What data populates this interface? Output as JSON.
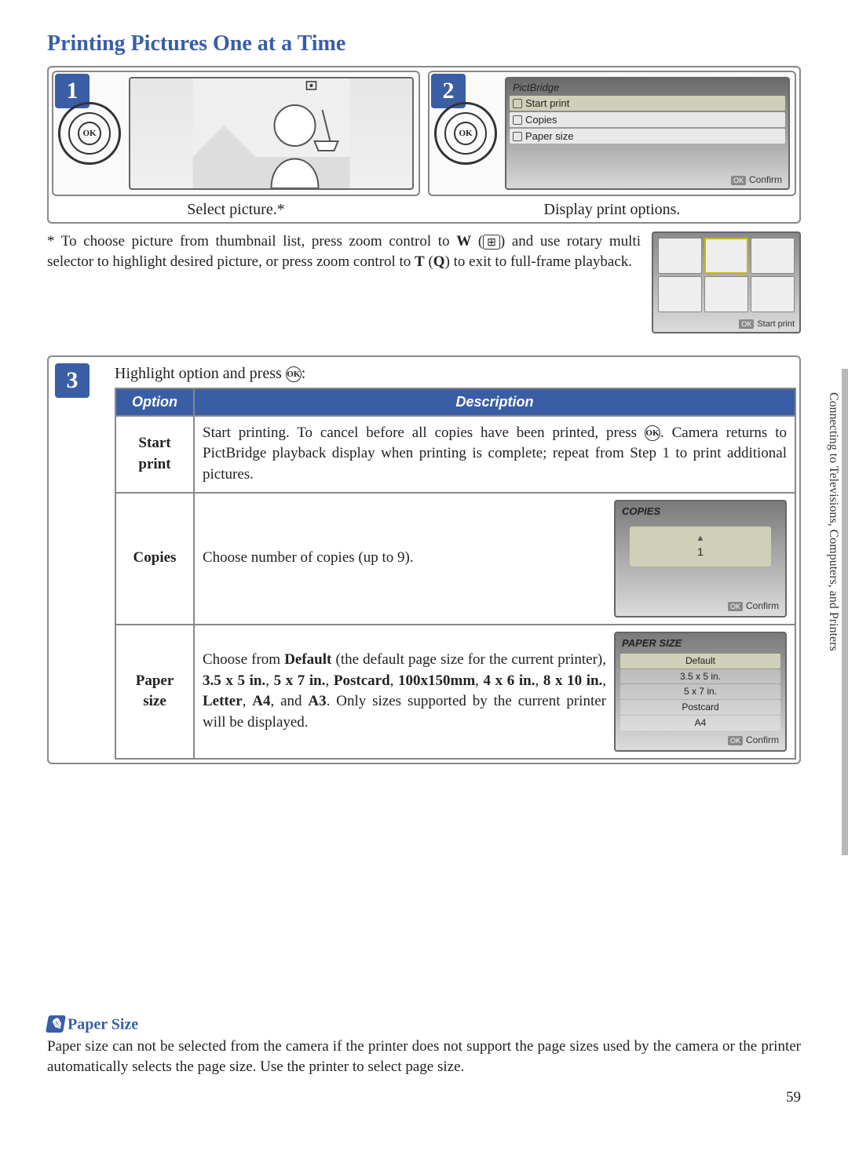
{
  "title": "Printing Pictures One at a Time",
  "sideTab": "Connecting to Televisions, Computers, and Printers",
  "pageNumber": "59",
  "steps": {
    "s1": {
      "num": "1",
      "caption": "Select picture.*"
    },
    "s2": {
      "num": "2",
      "caption": "Display print options.",
      "menuTitle": "PictBridge",
      "menu": {
        "startPrint": "Start print",
        "copies": "Copies",
        "paperSize": "Paper size",
        "confirm": "Confirm"
      }
    }
  },
  "footnote": {
    "line1a": "* To choose picture from thumbnail list, press zoom control to ",
    "w": "W",
    "line1b": " (",
    "thumbSym": "⊞",
    "line1c": ") and use rotary multi selector to highlight desired picture, or press zoom control to ",
    "t": "T",
    "q": "Q",
    "line1d": ") to exit to full-frame playback.",
    "thumbFooter": "Start print"
  },
  "step3": {
    "num": "3",
    "intro": "Highlight option and press ",
    "headers": {
      "option": "Option",
      "description": "Description"
    },
    "rows": {
      "startPrint": {
        "name": "Start print",
        "desc1": "Start printing.  To cancel before all copies have been printed, press ",
        "desc2": ". Camera returns to PictBridge playback display when printing is complete; repeat from Step 1 to print additional pictures."
      },
      "copies": {
        "name": "Copies",
        "desc": "Choose number of copies (up to 9).",
        "screenTitle": "COPIES",
        "value": "1",
        "confirm": "Confirm"
      },
      "paperSize": {
        "name": "Paper size",
        "desc1": "Choose from ",
        "default": "Default",
        "desc2": " (the default page size for the current printer), ",
        "s35": "3.5 x 5 in.",
        "s57": "5 x 7 in.",
        "postcard": "Postcard",
        "s100": "100x150mm",
        "s46": "4 x 6 in.",
        "s810": "8 x 10 in.",
        "letter": "Letter",
        "a4": "A4",
        "desc3": ", and ",
        "a3": "A3",
        "desc4": ".  Only sizes supported by the current printer will be displayed.",
        "screenTitle": "PAPER SIZE",
        "list": {
          "default": "Default",
          "s35": "3.5 x 5 in.",
          "s57": "5 x 7 in.",
          "postcard": "Postcard",
          "a4": "A4"
        },
        "confirm": "Confirm"
      }
    }
  },
  "note": {
    "title": "Paper Size",
    "body": "Paper size can not be selected from the camera if the printer does not support the page sizes used by the camera or the printer automatically selects the page size.  Use the printer to select page size."
  }
}
